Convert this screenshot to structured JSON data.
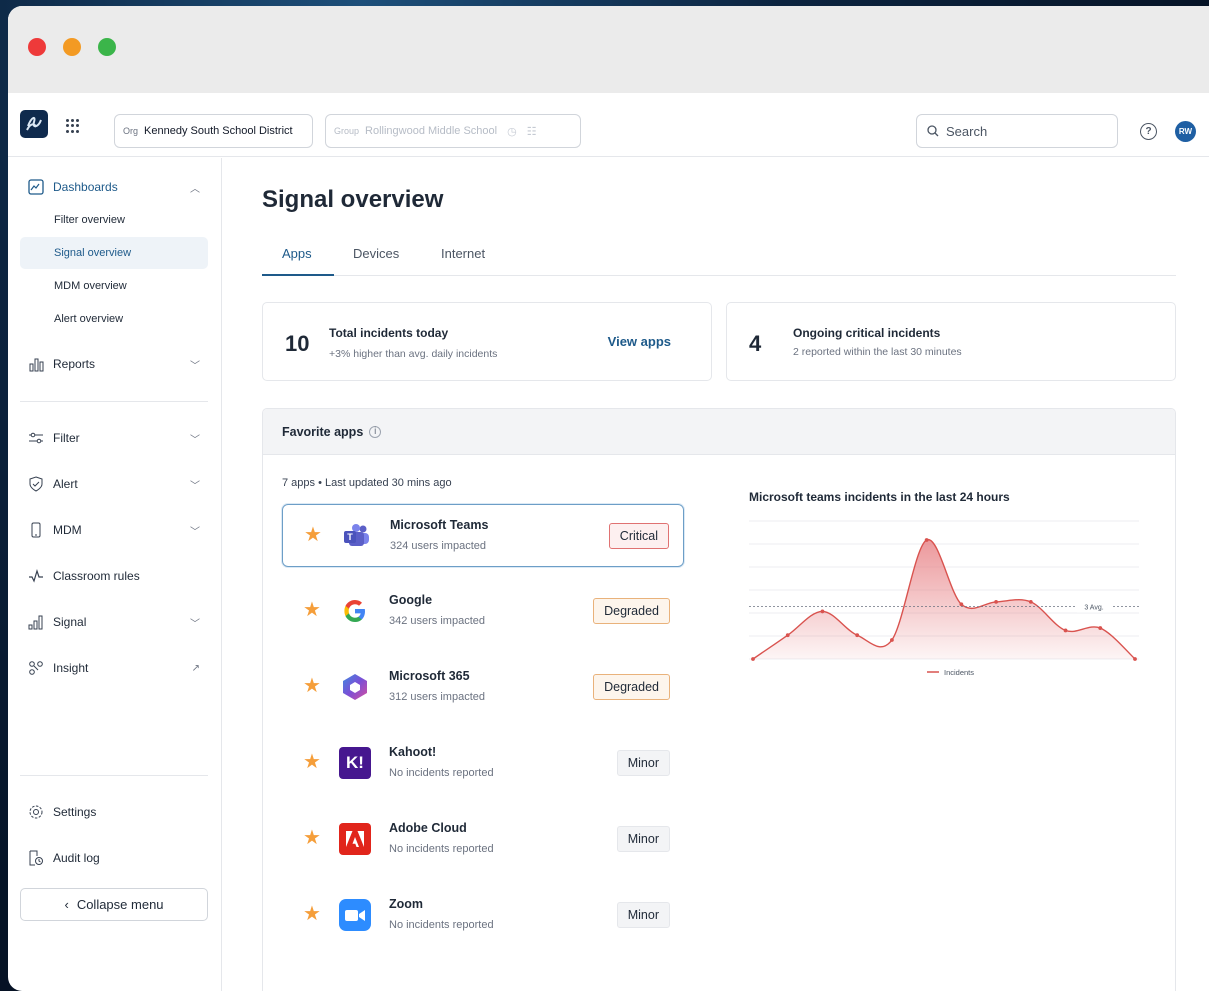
{
  "topbar": {
    "org_tag": "Org",
    "org_value": "Kennedy South School District",
    "group_tag": "Group",
    "group_value": "Rollingwood Middle School",
    "search_placeholder": "Search",
    "help_label": "?",
    "avatar_initials": "RW"
  },
  "sidebar": {
    "dashboards_label": "Dashboards",
    "sub_items": [
      "Filter overview",
      "Signal overview",
      "MDM overview",
      "Alert overview"
    ],
    "reports_label": "Reports",
    "filter_label": "Filter",
    "alert_label": "Alert",
    "mdm_label": "MDM",
    "classroom_label": "Classroom rules",
    "signal_label": "Signal",
    "insight_label": "Insight",
    "settings_label": "Settings",
    "audit_label": "Audit log",
    "collapse_label": "Collapse menu"
  },
  "main": {
    "title": "Signal overview",
    "tabs": [
      "Apps",
      "Devices",
      "Internet"
    ],
    "stat1": {
      "number": "10",
      "title": "Total incidents today",
      "sub": "+3% higher than avg. daily incidents",
      "link": "View apps"
    },
    "stat2": {
      "number": "4",
      "title": "Ongoing critical incidents",
      "sub": "2 reported within the last 30 minutes"
    },
    "favorites": {
      "header": "Favorite apps",
      "meta": "7 apps • Last updated 30 mins ago",
      "apps": [
        {
          "name": "Microsoft Teams",
          "sub": "324 users impacted",
          "status": "Critical",
          "icon": "teams-icon"
        },
        {
          "name": "Google",
          "sub": "342 users impacted",
          "status": "Degraded",
          "icon": "google-icon"
        },
        {
          "name": "Microsoft 365",
          "sub": "312 users impacted",
          "status": "Degraded",
          "icon": "microsoft365-icon"
        },
        {
          "name": "Kahoot!",
          "sub": "No incidents reported",
          "status": "Minor",
          "icon": "kahoot-icon"
        },
        {
          "name": "Adobe Cloud",
          "sub": "No incidents reported",
          "status": "Minor",
          "icon": "adobe-icon"
        },
        {
          "name": "Zoom",
          "sub": "No incidents reported",
          "status": "Minor",
          "icon": "zoom-icon"
        }
      ]
    }
  },
  "chart_data": {
    "type": "area",
    "title": "Microsoft teams incidents in the last 24 hours",
    "series": [
      {
        "name": "Incidents",
        "values": [
          0,
          1,
          2,
          1,
          0.8,
          5,
          2.3,
          2.4,
          2.4,
          1.2,
          1.3,
          0
        ]
      }
    ],
    "avg_line": {
      "value": 2.2,
      "label": "3 Avg."
    },
    "ylim": [
      0,
      5.8
    ],
    "grid": true,
    "legend": "bottom",
    "colors": {
      "line": "#d9534f",
      "fill": "#e8868a"
    }
  }
}
